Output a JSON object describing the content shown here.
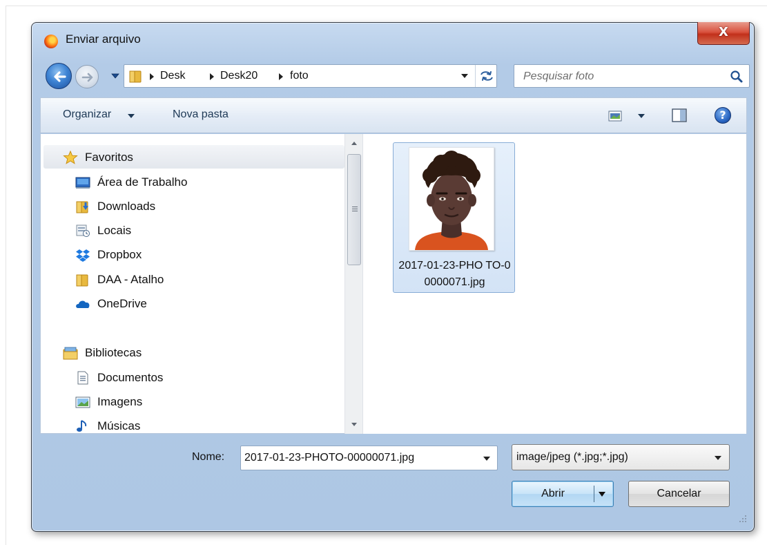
{
  "window": {
    "title": "Enviar arquivo",
    "close_label": "X"
  },
  "address": {
    "crumbs": [
      "Desk",
      "Desk20",
      "foto"
    ]
  },
  "search": {
    "placeholder": "Pesquisar foto"
  },
  "toolbar": {
    "organize_label": "Organizar",
    "new_folder_label": "Nova pasta",
    "help_label": "?"
  },
  "sidebar": {
    "favorites": {
      "label": "Favoritos",
      "items": [
        {
          "label": "Área de Trabalho",
          "icon": "desktop-icon"
        },
        {
          "label": "Downloads",
          "icon": "downloads-folder-icon"
        },
        {
          "label": "Locais",
          "icon": "recent-places-icon"
        },
        {
          "label": "Dropbox",
          "icon": "dropbox-icon"
        },
        {
          "label": "DAA - Atalho",
          "icon": "folder-icon"
        },
        {
          "label": "OneDrive",
          "icon": "onedrive-icon"
        }
      ]
    },
    "libraries": {
      "label": "Bibliotecas",
      "items": [
        {
          "label": "Documentos",
          "icon": "document-icon"
        },
        {
          "label": "Imagens",
          "icon": "picture-icon"
        },
        {
          "label": "Músicas",
          "icon": "music-icon"
        }
      ]
    }
  },
  "files": [
    {
      "name": "2017-01-23-PHOTO-00000071.jpg",
      "display_name": "2017-01-23-PHO TO-00000071.jpg",
      "selected": true
    }
  ],
  "footer": {
    "name_label": "Nome:",
    "name_value": "2017-01-23-PHOTO-00000071.jpg",
    "filter_value": "image/jpeg (*.jpg;*.jpg)",
    "open_label": "Abrir",
    "cancel_label": "Cancelar"
  },
  "colors": {
    "title_bar": "#b9d1ea",
    "selection": "#d3e3f6",
    "close_button": "#c7422b",
    "primary_button": "#c6e2f7"
  }
}
